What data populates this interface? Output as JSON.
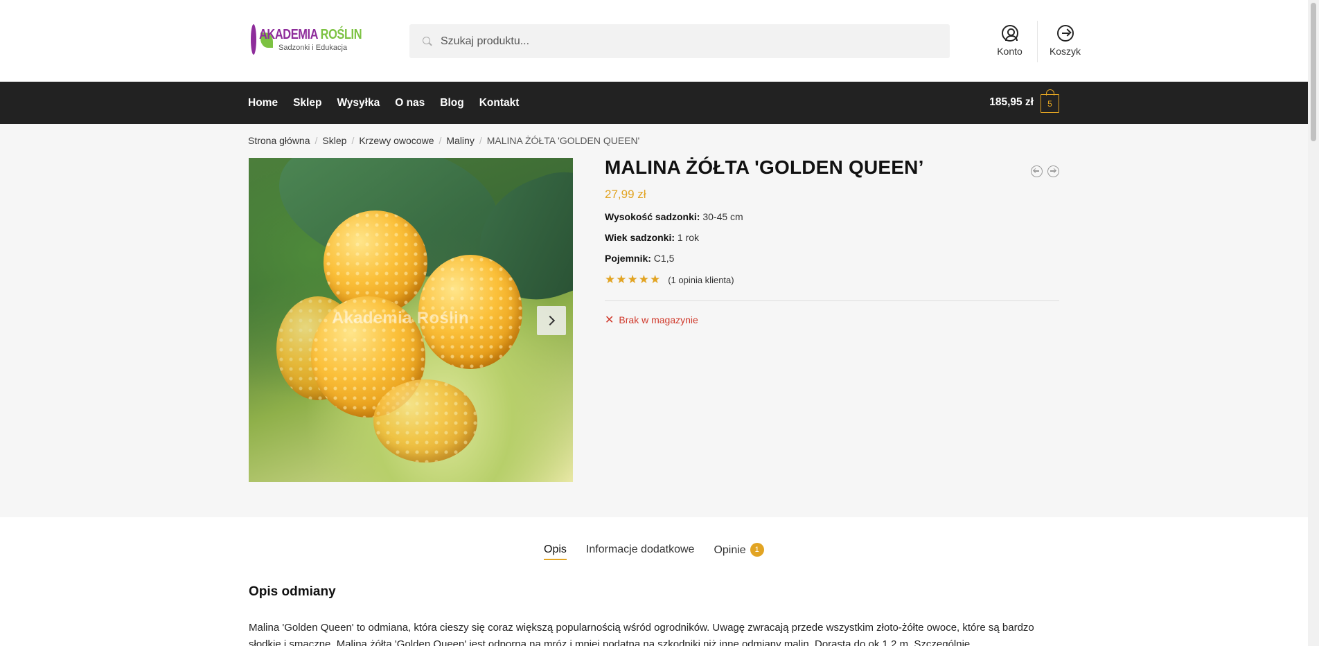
{
  "header": {
    "logo": {
      "title_part1": "AKADEMIA ",
      "title_part2": "ROŚLIN",
      "subtitle": "Sadzonki i Edukacja"
    },
    "search": {
      "placeholder": "Szukaj produktu..."
    },
    "links": {
      "account": "Konto",
      "cart": "Koszyk"
    }
  },
  "nav": {
    "items": [
      "Home",
      "Sklep",
      "Wysyłka",
      "O nas",
      "Blog",
      "Kontakt"
    ],
    "cart_total": "185,95 zł",
    "cart_count": "5"
  },
  "breadcrumb": {
    "items": [
      "Strona główna",
      "Sklep",
      "Krzewy owocowe",
      "Maliny"
    ],
    "current": "MALINA ŻÓŁTA 'GOLDEN QUEEN'",
    "separator": "/"
  },
  "gallery": {
    "watermark": "Akademia Roślin"
  },
  "product": {
    "title": "MALINA ŻÓŁTA 'GOLDEN QUEEN’",
    "price": "27,99 zł",
    "attributes": [
      {
        "label": "Wysokość sadzonki:",
        "value": "30-45 cm"
      },
      {
        "label": "Wiek sadzonki:",
        "value": "1 rok"
      },
      {
        "label": "Pojemnik:",
        "value": "C1,5"
      }
    ],
    "rating": {
      "stars": "★★★★★",
      "value": 5,
      "max": 5,
      "reviews_text": "(1 opinia klienta)"
    },
    "stock": {
      "icon": "✕",
      "text": "Brak w magazynie"
    }
  },
  "tabs": [
    {
      "label": "Opis"
    },
    {
      "label": "Informacje dodatkowe"
    },
    {
      "label": "Opinie",
      "badge": "1"
    }
  ],
  "description": {
    "title": "Opis odmiany",
    "text": "Malina 'Golden Queen' to odmiana, która cieszy się coraz większą popularnością wśród ogrodników. Uwagę zwracają przede wszystkim złoto-żółte owoce, które są bardzo słodkie i smaczne. Malina żółta 'Golden Queen' jest odporna na mróz i mniej podatna na szkodniki niż inne odmiany malin. Dorasta do ok 1,2 m. Szczególnie"
  },
  "colors": {
    "accent": "#e2a423",
    "nav_bg": "#222222",
    "out_of_stock": "#d0392b",
    "logo_purple": "#8e2d9b",
    "logo_green": "#7cc242"
  }
}
